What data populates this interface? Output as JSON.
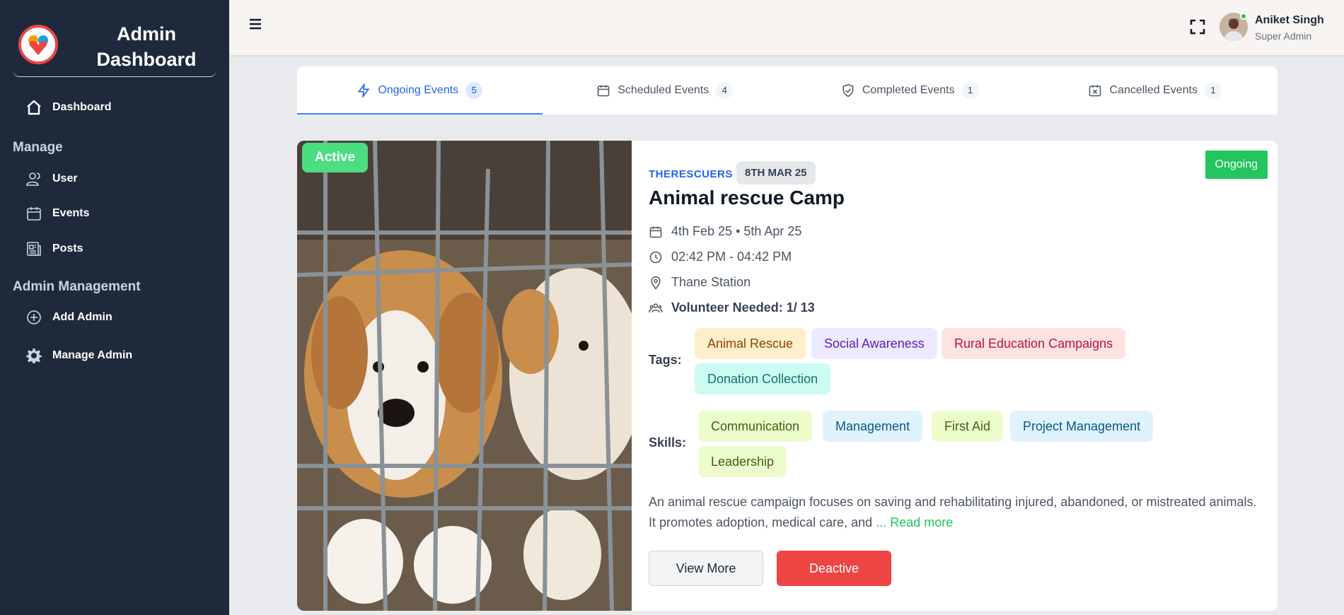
{
  "sidebar": {
    "brand_title": "Admin Dashboard",
    "dashboard": "Dashboard",
    "manage_title": "Manage",
    "manage_items": [
      "User",
      "Events",
      "Posts"
    ],
    "admin_title": "Admin Management",
    "admin_items": [
      "Add Admin",
      "Manage Admin"
    ]
  },
  "header": {
    "user_name": "Aniket Singh",
    "user_role": "Super Admin"
  },
  "tabs": [
    {
      "label": "Ongoing Events",
      "count": "5"
    },
    {
      "label": "Scheduled Events",
      "count": "4"
    },
    {
      "label": "Completed Events",
      "count": "1"
    },
    {
      "label": "Cancelled Events",
      "count": "1"
    }
  ],
  "event": {
    "badge": "Active",
    "status": "Ongoing",
    "org": "THERESCUERS",
    "date": "8TH MAR 25",
    "title": "Animal rescue Camp",
    "dates": "4th Feb 25 • 5th Apr 25",
    "time": "02:42 PM - 04:42 PM",
    "location": "Thane Station",
    "volunteers": "Volunteer Needed: 1/ 13",
    "tags_label": "Tags:",
    "tags": [
      "Animal Rescue",
      "Social Awareness",
      "Rural Education Campaigns",
      "Donation Collection"
    ],
    "skills_label": "Skills:",
    "skills": [
      "Communication",
      "Management",
      "First Aid",
      "Project Management",
      "Leadership"
    ],
    "description": "An animal rescue campaign focuses on saving and rehabilitating injured, abandoned, or mistreated animals. It promotes adoption, medical care, and",
    "read_more": "... Read more",
    "view_more": "View More",
    "deactive": "Deactive"
  },
  "colors": {
    "sidebar_bg": "#1e293b",
    "accent": "#2563eb",
    "success": "#22c55e",
    "danger": "#ef4444"
  }
}
